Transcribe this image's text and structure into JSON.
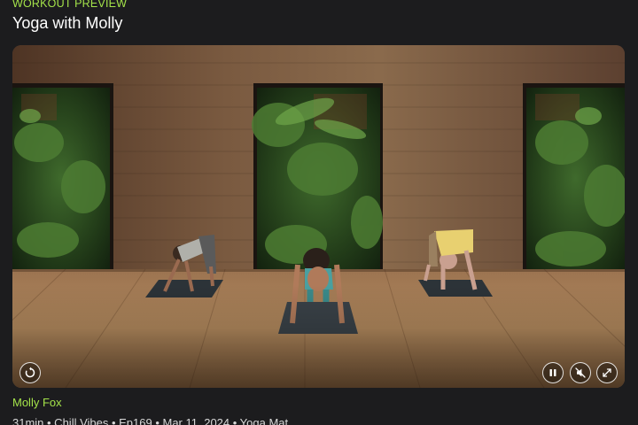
{
  "header": {
    "eyebrow": "WORKOUT PREVIEW",
    "title": "Yoga with Molly"
  },
  "player": {
    "controls": {
      "replay_icon": "replay-icon",
      "pause_icon": "pause-icon",
      "mute_icon": "speaker-muted-icon",
      "fullscreen_icon": "expand-icon"
    }
  },
  "details": {
    "trainer": "Molly Fox",
    "meta": "31min • Chill Vibes • Ep169 • Mar 11, 2024 • Yoga Mat"
  },
  "colors": {
    "accent": "#a4e34a",
    "background": "#1c1c1e"
  }
}
